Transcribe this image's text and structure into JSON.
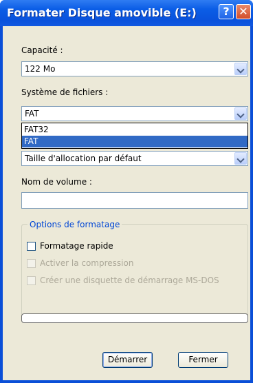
{
  "window": {
    "title": "Formater Disque amovible (E:)"
  },
  "titlebar": {
    "help_label": "?",
    "close_label": "✕"
  },
  "capacity": {
    "label": "Capacité :",
    "value": "122 Mo"
  },
  "filesystem": {
    "label": "Système de fichiers :",
    "value": "FAT",
    "options": [
      "FAT32",
      "FAT"
    ],
    "selected_index": 1
  },
  "allocation": {
    "value": "Taille d'allocation par défaut"
  },
  "volume": {
    "label": "Nom de volume :",
    "value": ""
  },
  "options": {
    "legend": "Options de formatage",
    "quick_format": "Formatage rapide",
    "compression": "Activer la compression",
    "msdos_disk": "Créer une disquette de démarrage MS-DOS"
  },
  "progress": {
    "percent": 0
  },
  "buttons": {
    "start": "Démarrer",
    "close": "Fermer"
  },
  "colors": {
    "title_blue": "#0a52dc",
    "selection": "#316ac5",
    "legend_blue": "#0046d5"
  }
}
